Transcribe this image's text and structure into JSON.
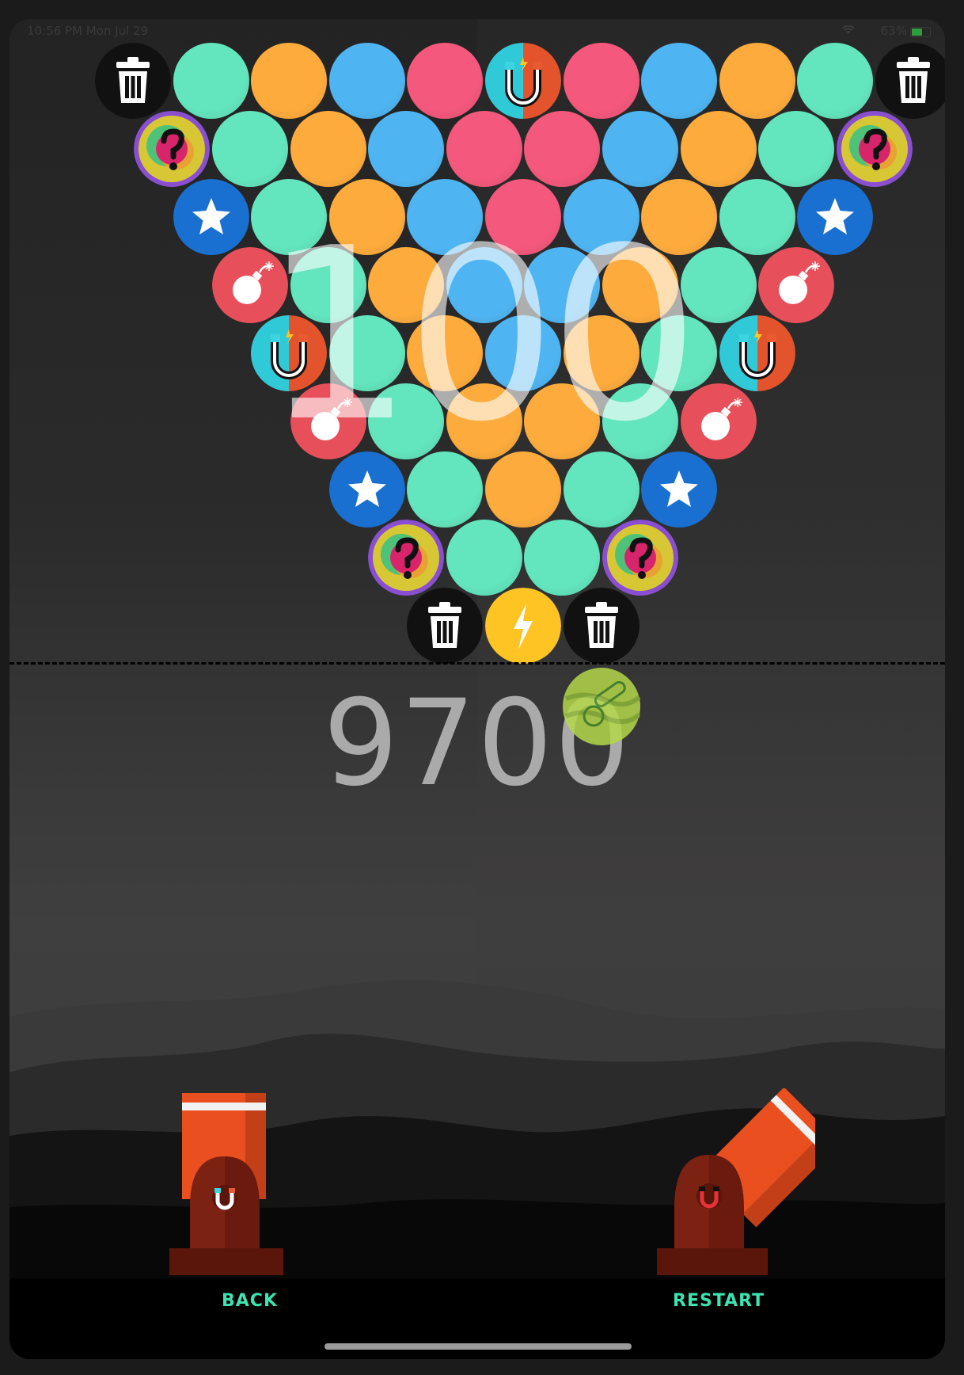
{
  "status_bar": {
    "time": "10:56 PM  Mon Jul 29",
    "battery": "63%"
  },
  "colors": {
    "mint": "#63e5bd",
    "orange": "#fdab3c",
    "blue": "#4fb5f2",
    "pink": "#f4587c",
    "star_blue": "#1a70d1",
    "bomb_red": "#e7505a",
    "lightning_yellow": "#fdc424",
    "trash_black": "#111111",
    "label_green": "#3de3b1",
    "cannon_orange": "#ea4f20",
    "cannon_dark": "#6a1a0e"
  },
  "board": {
    "rows": [
      [
        "trash",
        "mint",
        "orange",
        "blue",
        "pink",
        "magnet",
        "pink",
        "blue",
        "orange",
        "mint",
        "trash"
      ],
      [
        "mystery",
        "mint",
        "orange",
        "blue",
        "pink",
        "pink",
        "blue",
        "orange",
        "mint",
        "mystery"
      ],
      [
        "star",
        "mint",
        "orange",
        "blue",
        "pink",
        "blue",
        "orange",
        "mint",
        "star"
      ],
      [
        "bomb",
        "mint",
        "orange",
        "blue",
        "blue",
        "orange",
        "mint",
        "bomb"
      ],
      [
        "magnet",
        "mint",
        "orange",
        "blue",
        "orange",
        "mint",
        "magnet"
      ],
      [
        "bomb",
        "mint",
        "orange",
        "orange",
        "mint",
        "bomb"
      ],
      [
        "star",
        "mint",
        "orange",
        "mint",
        "star"
      ],
      [
        "mystery",
        "mint",
        "mint",
        "mystery"
      ],
      [
        "trash",
        "lightning",
        "trash"
      ]
    ]
  },
  "shots_remaining": "100",
  "score": "9700",
  "flying_bubble": "saw",
  "cannons": {
    "left_ammo": "magnet",
    "right_ammo": "magnet-red"
  },
  "buttons": {
    "back": "BACK",
    "restart": "RESTART"
  }
}
